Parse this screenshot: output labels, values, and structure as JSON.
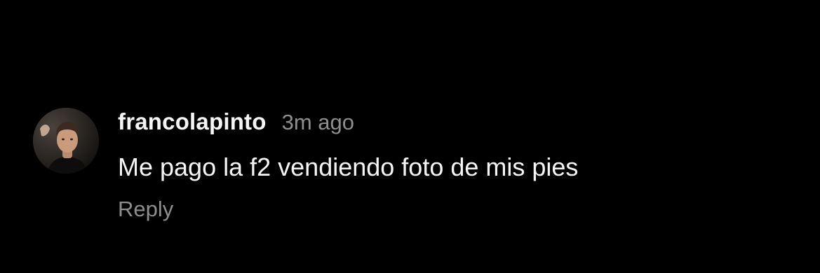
{
  "comment": {
    "avatar_icon": "user-avatar-photo",
    "username": "francolapinto",
    "timestamp": "3m ago",
    "text": "Me pago la f2 vendiendo foto de mis pies",
    "reply_label": "Reply"
  },
  "colors": {
    "background": "#000000",
    "primary_text": "#f5f5f5",
    "secondary_text": "#8e8e8e"
  }
}
